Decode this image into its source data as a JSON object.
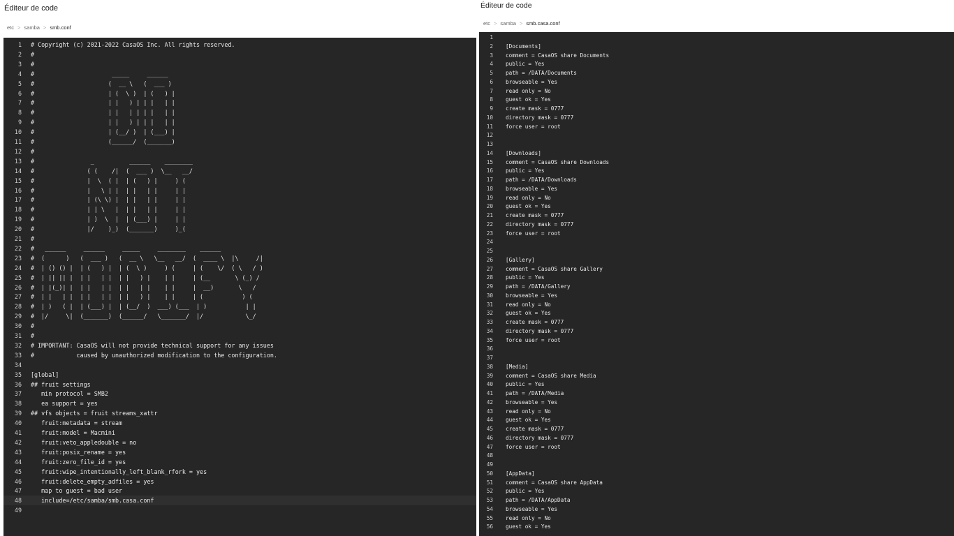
{
  "left": {
    "title": "Éditeur de code",
    "breadcrumb": [
      "etc",
      "samba",
      "smb.conf"
    ],
    "active_line": 48,
    "lines": [
      "# Copyright (c) 2021-2022 CasaOS Inc. All rights reserved.",
      "#",
      "#",
      "#                      _____     ______",
      "#                     (  __ \\   (  ___ )",
      "#                     | (  \\ )  | (   ) |",
      "#                     | |   ) | | |   | |",
      "#                     | |   | | | |   | |",
      "#                     | |   ) | | |   | |",
      "#                     | (__/ )  | (___) |",
      "#                     (______/  (_______)",
      "#",
      "#                _          ______    ________",
      "#               ( (    /|  (  ___ )  \\__   __/",
      "#               |  \\  ( |  | (   ) |     ) (",
      "#               |   \\ | |  | |   | |     | |",
      "#               | (\\ \\) |  | |   | |     | |",
      "#               | | \\   |  | |   | |     | |",
      "#               | )  \\  |  | (___) |     | |",
      "#               |/    )_)  (_______)     )_(",
      "#",
      "#   ______     ______     _____     ________    ______",
      "#  (      )   (  ___ )   (  __ \\   \\__   __/  (  ____ \\  |\\     /|",
      "#  | () () |  | (   ) |  | (  \\ )     ) (     | (    \\/  ( \\   / )",
      "#  | || || |  | |   | |  | |   ) |    | |     | (__       \\ (_) /",
      "#  | |(_)| |  | |   | |  | |   | |    | |     |  __)       \\   /",
      "#  | |   | |  | |   | |  | |   ) |    | |     | (           ) (",
      "#  | )   ( |  | (___) |  | (__/  )  ___) (___  | )           | |",
      "#  |/     \\|  (_______)  (______/   \\_______/  |/            \\_/",
      "#",
      "#",
      "# IMPORTANT: CasaOS will not provide technical support for any issues",
      "#            caused by unauthorized modification to the configuration.",
      "",
      "[global]",
      "## fruit settings",
      "   min protocol = SMB2",
      "   ea support = yes",
      "## vfs objects = fruit streams_xattr",
      "   fruit:metadata = stream",
      "   fruit:model = Macmini",
      "   fruit:veto_appledouble = no",
      "   fruit:posix_rename = yes",
      "   fruit:zero_file_id = yes",
      "   fruit:wipe_intentionally_left_blank_rfork = yes",
      "   fruit:delete_empty_adfiles = yes",
      "   map to guest = bad user",
      "   include=/etc/samba/smb.casa.conf",
      ""
    ]
  },
  "right": {
    "title": "Éditeur de code",
    "breadcrumb": [
      "etc",
      "samba",
      "smb.casa.conf"
    ],
    "lines": [
      "",
      "[Documents]",
      "comment = CasaOS share Documents",
      "public = Yes",
      "path = /DATA/Documents",
      "browseable = Yes",
      "read only = No",
      "guest ok = Yes",
      "create mask = 0777",
      "directory mask = 0777",
      "force user = root",
      "",
      "",
      "[Downloads]",
      "comment = CasaOS share Downloads",
      "public = Yes",
      "path = /DATA/Downloads",
      "browseable = Yes",
      "read only = No",
      "guest ok = Yes",
      "create mask = 0777",
      "directory mask = 0777",
      "force user = root",
      "",
      "",
      "[Gallery]",
      "comment = CasaOS share Gallery",
      "public = Yes",
      "path = /DATA/Gallery",
      "browseable = Yes",
      "read only = No",
      "guest ok = Yes",
      "create mask = 0777",
      "directory mask = 0777",
      "force user = root",
      "",
      "",
      "[Media]",
      "comment = CasaOS share Media",
      "public = Yes",
      "path = /DATA/Media",
      "browseable = Yes",
      "read only = No",
      "guest ok = Yes",
      "create mask = 0777",
      "directory mask = 0777",
      "force user = root",
      "",
      "",
      "[AppData]",
      "comment = CasaOS share AppData",
      "public = Yes",
      "path = /DATA/AppData",
      "browseable = Yes",
      "read only = No",
      "guest ok = Yes"
    ]
  }
}
